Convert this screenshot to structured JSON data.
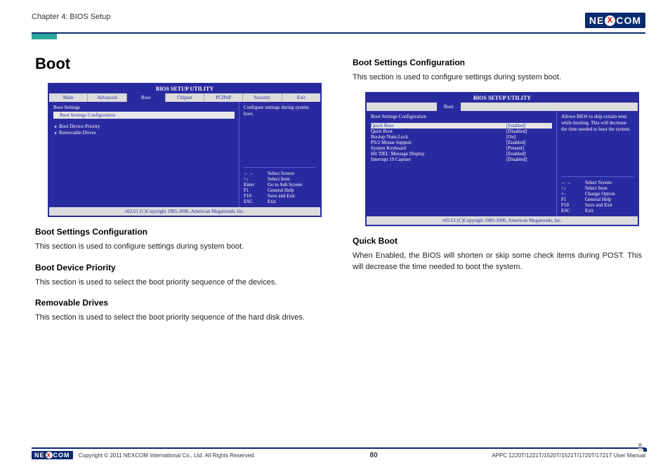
{
  "header": {
    "chapter": "Chapter 4: BIOS Setup",
    "logo_pre": "NE",
    "logo_x": "X",
    "logo_post": "COM"
  },
  "left": {
    "title": "Boot",
    "bios1": {
      "title": "BIOS SETUP UTILITY",
      "tabs": [
        "Main",
        "Advanced",
        "Boot",
        "Chipset",
        "PCIPnP",
        "Security",
        "Exit"
      ],
      "active_tab_index": 2,
      "left_section_label": "Boot Settings",
      "hl_item": "Boot Settings Configuration",
      "sub_items": [
        "Boot Device Priority",
        "Removable Drives"
      ],
      "help_top": "Configure settings during system boot.",
      "keys": [
        {
          "k": "←→",
          "v": "Select Screen"
        },
        {
          "k": "↑↓",
          "v": "Select Item"
        },
        {
          "k": "Enter",
          "v": "Go to Sub Screen"
        },
        {
          "k": "F1",
          "v": "General Help"
        },
        {
          "k": "F10",
          "v": "Save and Exit"
        },
        {
          "k": "ESC",
          "v": "Exit"
        }
      ],
      "copyright": "v02.61 (C)Copyright 1985-2006, American Megatrends, Inc."
    },
    "s1_h": "Boot Settings Configuration",
    "s1_p": "This section is used to configure settings during system boot.",
    "s2_h": "Boot Device Priority",
    "s2_p": "This section is used to select the boot priority sequence of the devices.",
    "s3_h": "Removable Drives",
    "s3_p": "This section is used to select the boot priority sequence of the hard disk drives."
  },
  "right": {
    "h1": "Boot Settings Configuration",
    "p1": "This section is used to configure settings during system boot.",
    "bios2": {
      "title": "BIOS SETUP UTILITY",
      "single_tab": "Boot",
      "left_section_label": "Boot Settings Configuration",
      "rows": [
        {
          "k": "Quick Boot",
          "v": "[Enabled]",
          "hl": true
        },
        {
          "k": "Quiet Boot",
          "v": "[Disabled]"
        },
        {
          "k": "Bootup Num-Lock",
          "v": "[On]"
        },
        {
          "k": "PS/2 Mouse Support",
          "v": "[Enabled]"
        },
        {
          "k": "System Keyboard",
          "v": "[Present]"
        },
        {
          "k": "Hit 'DEL' Message Display",
          "v": "[Enabled]"
        },
        {
          "k": "Interrupt 19 Capture",
          "v": "[Disabled]"
        }
      ],
      "help_top": "Allows BIOS to skip certain tests while booting. This will decrease the time needed to boot the system.",
      "keys": [
        {
          "k": "←→",
          "v": "Select Screen"
        },
        {
          "k": "↑↓",
          "v": "Select Item"
        },
        {
          "k": "+-",
          "v": "Change Option"
        },
        {
          "k": "F1",
          "v": "General Help"
        },
        {
          "k": "F10",
          "v": "Save and Exit"
        },
        {
          "k": "ESC",
          "v": "Exit"
        }
      ],
      "copyright": "v02.61 (C)Copyright 1985-2006, American Megatrends, Inc."
    },
    "h2": "Quick Boot",
    "p2": "When Enabled, the BIOS will shorten or skip some check items during POST. This will decrease the time needed to boot the system."
  },
  "footer": {
    "copyright": "Copyright © 2011 NEXCOM International Co., Ltd. All Rights Reserved.",
    "page": "80",
    "manual": "APPC 1220T/1221T/1520T/1521T/1720T/1721T User Manual"
  }
}
